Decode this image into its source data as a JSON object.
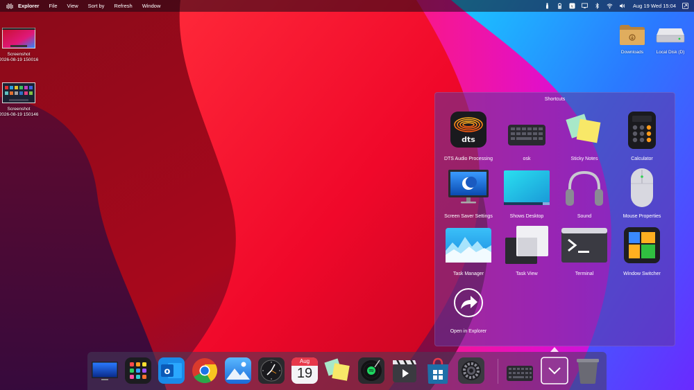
{
  "menubar": {
    "app_name": "Explorer",
    "menus": [
      "File",
      "View",
      "Sort by",
      "Refresh",
      "Window"
    ],
    "status_icons": [
      "flashlight-icon",
      "battery-icon",
      "tray-app-icon",
      "screen-icon",
      "bluetooth-icon",
      "wifi-icon",
      "volume-icon"
    ],
    "clock": "Aug 19 Wed 15:04"
  },
  "desktop": {
    "left_icons": [
      {
        "label_line1": "Screenshot",
        "label_line2": "2026-08-19 150016"
      },
      {
        "label_line1": "Screenshot",
        "label_line2": "2026-08-19 150146"
      }
    ],
    "right_icons": [
      {
        "label": "Downloads",
        "icon": "folder-icon"
      },
      {
        "label": "Local Disk (D)",
        "icon": "drive-icon"
      }
    ]
  },
  "shortcuts": {
    "title": "Shortcuts",
    "items": [
      {
        "label": "DTS Audio Processing",
        "icon": "dts-icon",
        "logo_text": "dts"
      },
      {
        "label": "osk",
        "icon": "keyboard-icon"
      },
      {
        "label": "Sticky Notes",
        "icon": "sticky-notes-icon"
      },
      {
        "label": "Calculator",
        "icon": "calculator-icon"
      },
      {
        "label": "Screen Saver Settings",
        "icon": "monitor-moon-icon"
      },
      {
        "label": "Shows Desktop",
        "icon": "desktop-icon"
      },
      {
        "label": "Sound",
        "icon": "headphones-icon"
      },
      {
        "label": "Mouse Properties",
        "icon": "mouse-icon"
      },
      {
        "label": "Task Manager",
        "icon": "task-manager-icon"
      },
      {
        "label": "Task View",
        "icon": "task-view-icon"
      },
      {
        "label": "Terminal",
        "icon": "terminal-icon"
      },
      {
        "label": "Window Switcher",
        "icon": "window-switcher-icon"
      },
      {
        "label": "Open in Explorer",
        "icon": "share-arrow-icon"
      }
    ]
  },
  "dock": {
    "calendar": {
      "month": "Aug",
      "day": "19"
    },
    "items": [
      "monitor-icon",
      "launchpad-icon",
      "outlook-icon",
      "chrome-icon",
      "photos-icon",
      "clock-icon",
      "calendar-icon",
      "sticky-notes-icon",
      "spotify-icon",
      "video-editor-icon",
      "store-icon",
      "settings-gear-icon",
      "keyboard-icon",
      "shortcuts-toggle-icon",
      "trash-icon"
    ],
    "colors": {
      "outlook": "#0a64c8",
      "store": "#1e6fa8",
      "accent": "#ffffff"
    }
  }
}
